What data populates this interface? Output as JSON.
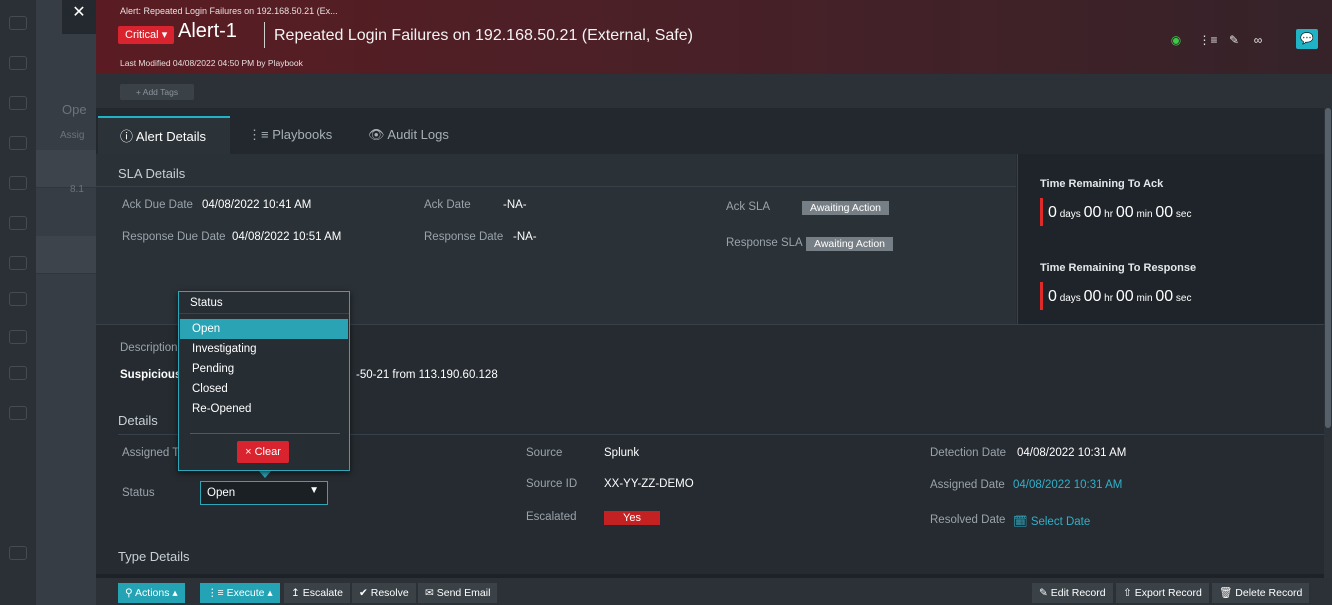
{
  "header": {
    "close_icon": "✕",
    "breadcrumb": "Alert: Repeated Login Failures on 192.168.50.21 (Ex...",
    "severity": "Critical",
    "alert_id": "Alert-1",
    "title": "Repeated Login Failures on 192.168.50.21 (External, Safe)",
    "last_modified": "Last Modified 04/08/2022 04:50 PM by Playbook",
    "icons": [
      "status-dot-icon",
      "playbook-icon",
      "edit-icon",
      "link-icon",
      "chat-icon"
    ]
  },
  "tags": {
    "add_label": "+ Add Tags"
  },
  "tabs": [
    {
      "label": "Alert Details",
      "icon": "info-icon"
    },
    {
      "label": "Playbooks",
      "icon": "playbook-icon"
    },
    {
      "label": "Audit Logs",
      "icon": "eye-icon"
    }
  ],
  "sla": {
    "heading": "SLA Details",
    "ack_due_label": "Ack Due Date",
    "ack_due_value": "04/08/2022 10:41 AM",
    "ack_date_label": "Ack Date",
    "ack_date_value": "-NA-",
    "ack_sla_label": "Ack SLA",
    "ack_sla_value": "Awaiting Action",
    "resp_due_label": "Response Due Date",
    "resp_due_value": "04/08/2022 10:51 AM",
    "resp_date_label": "Response Date",
    "resp_date_value": "-NA-",
    "resp_sla_label": "Response SLA",
    "resp_sla_value": "Awaiting Action"
  },
  "time_remaining": {
    "ack_title": "Time Remaining To Ack",
    "resp_title": "Time Remaining To Response",
    "days": "0",
    "days_unit": "days",
    "hours": "00",
    "hours_unit": "hr",
    "mins": "00",
    "mins_unit": "min",
    "secs": "00",
    "secs_unit": "sec"
  },
  "description": {
    "label": "Description",
    "text_start": "Suspicious",
    "text_end": "-50-21 from 113.190.60.128"
  },
  "details": {
    "heading": "Details",
    "assigned_label": "Assigned To",
    "status_label": "Status",
    "status_value": "Open",
    "source_label": "Source",
    "source_value": "Splunk",
    "source_id_label": "Source ID",
    "source_id_value": "XX-YY-ZZ-DEMO",
    "escalated_label": "Escalated",
    "escalated_value": "Yes",
    "detection_label": "Detection Date",
    "detection_value": "04/08/2022 10:31 AM",
    "assigned_date_label": "Assigned Date",
    "assigned_date_value": "04/08/2022 10:31 AM",
    "resolved_label": "Resolved Date",
    "resolved_value": "Select Date"
  },
  "type_details": {
    "heading": "Type Details"
  },
  "status_dropdown": {
    "heading": "Status",
    "options": [
      "Open",
      "Investigating",
      "Pending",
      "Closed",
      "Re-Opened"
    ],
    "selected": "Open",
    "clear_label": "Clear"
  },
  "toolbar": {
    "actions": "Actions",
    "execute": "Execute",
    "escalate": "Escalate",
    "resolve": "Resolve",
    "send_email": "Send Email",
    "edit_record": "Edit Record",
    "export_record": "Export Record",
    "delete_record": "Delete Record"
  },
  "background": {
    "text1": "Ope",
    "text2": "Assig",
    "text3": "8.1"
  },
  "colors": {
    "accent": "#2aa3b5",
    "critical": "#d9242f",
    "header": "#5a1c22"
  }
}
